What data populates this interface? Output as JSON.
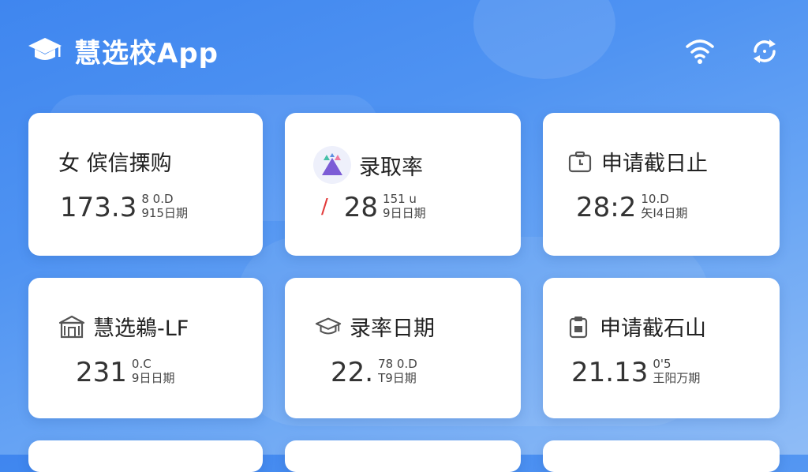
{
  "app": {
    "title": "慧选校App"
  },
  "cards": [
    {
      "title": "女 傧信搮购",
      "value": "173.3",
      "sub_top": "8 0.D",
      "sub_bottom": "915日期",
      "icon": "none"
    },
    {
      "title": "录取率",
      "value": "28",
      "sub_top": "151 u",
      "sub_bottom": "9日日期",
      "icon": "admission-triangles-icon",
      "prefix": "/"
    },
    {
      "title": "申请截日止",
      "value": "28:2",
      "sub_top": "10.D",
      "sub_bottom": "矢I4日期",
      "icon": "calendar-box-icon"
    },
    {
      "title": "慧选鵜-LF",
      "value": "231",
      "sub_top": "0.C",
      "sub_bottom": "9日日期",
      "icon": "school-building-icon"
    },
    {
      "title": "录率日期",
      "value": "22.",
      "sub_top": "78 0.D",
      "sub_bottom": "T9日期",
      "icon": "graduation-cap-icon"
    },
    {
      "title": "申请截石山",
      "value": "21.13",
      "sub_top": "0'5",
      "sub_bottom": "王阳万期",
      "icon": "clipboard-icon"
    }
  ],
  "colors": {
    "brand_blue": "#3f86ef",
    "icon_purple": "#7c5cd6",
    "accent_red": "#e23b3b"
  }
}
